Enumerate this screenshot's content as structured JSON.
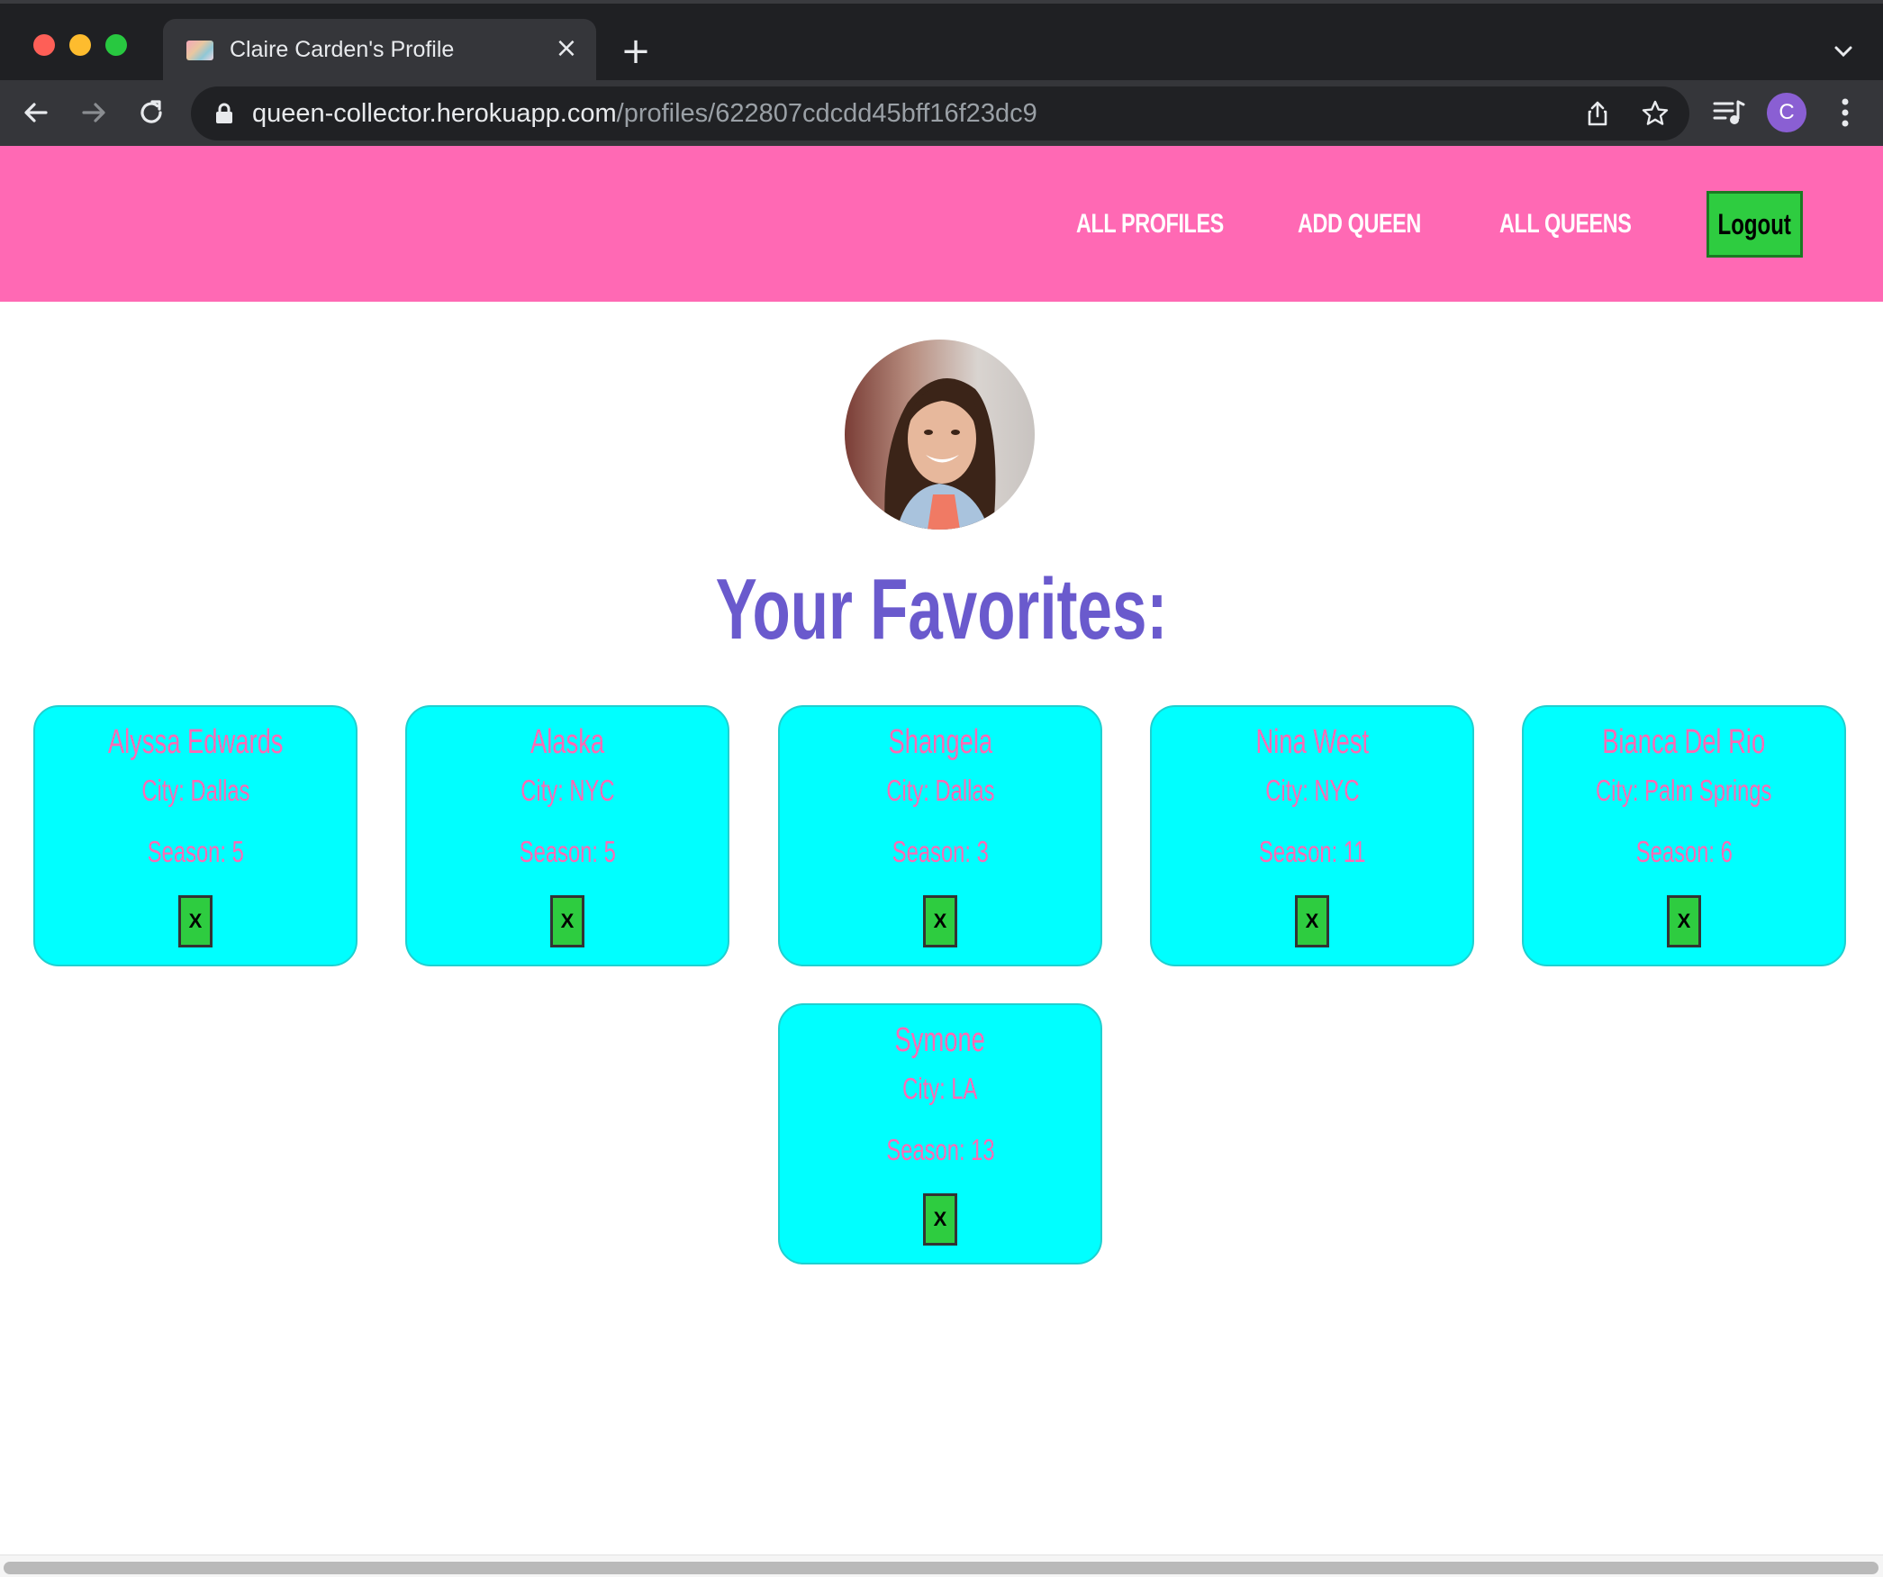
{
  "browser": {
    "tab_title": "Claire Carden's Profile",
    "url_host": "queen-collector.herokuapp.com",
    "url_path": "/profiles/622807cdcdd45bff16f23dc9",
    "profile_initial": "C",
    "icons": [
      "back-arrow-icon",
      "forward-arrow-icon",
      "reload-icon",
      "lock-icon",
      "share-icon",
      "star-icon",
      "media-control-icon",
      "kebab-menu-icon",
      "tab-list-chevron-icon",
      "close-icon",
      "plus-icon"
    ]
  },
  "nav": {
    "links": [
      "ALL PROFILES",
      "ADD QUEEN",
      "ALL QUEENS"
    ],
    "logout_label": "Logout"
  },
  "profile": {
    "heading": "Your Favorites:"
  },
  "favorites": [
    {
      "name": "Alyssa Edwards",
      "city": "City: Dallas",
      "season": "Season: 5",
      "remove_label": "X"
    },
    {
      "name": "Alaska",
      "city": "City: NYC",
      "season": "Season: 5",
      "remove_label": "X"
    },
    {
      "name": "Shangela",
      "city": "City: Dallas",
      "season": "Season: 3",
      "remove_label": "X"
    },
    {
      "name": "Nina West",
      "city": "City: NYC",
      "season": "Season: 11",
      "remove_label": "X"
    },
    {
      "name": "Bianca Del Rio",
      "city": "City: Palm Springs",
      "season": "Season: 6",
      "remove_label": "X"
    },
    {
      "name": "Symone",
      "city": "City: LA",
      "season": "Season: 13",
      "remove_label": "X"
    }
  ],
  "colors": {
    "nav_bg": "#ff69b4",
    "card_bg": "#00ffff",
    "card_text": "#ff69b4",
    "heading": "#6a5acd",
    "button_green": "#2ecc40"
  }
}
